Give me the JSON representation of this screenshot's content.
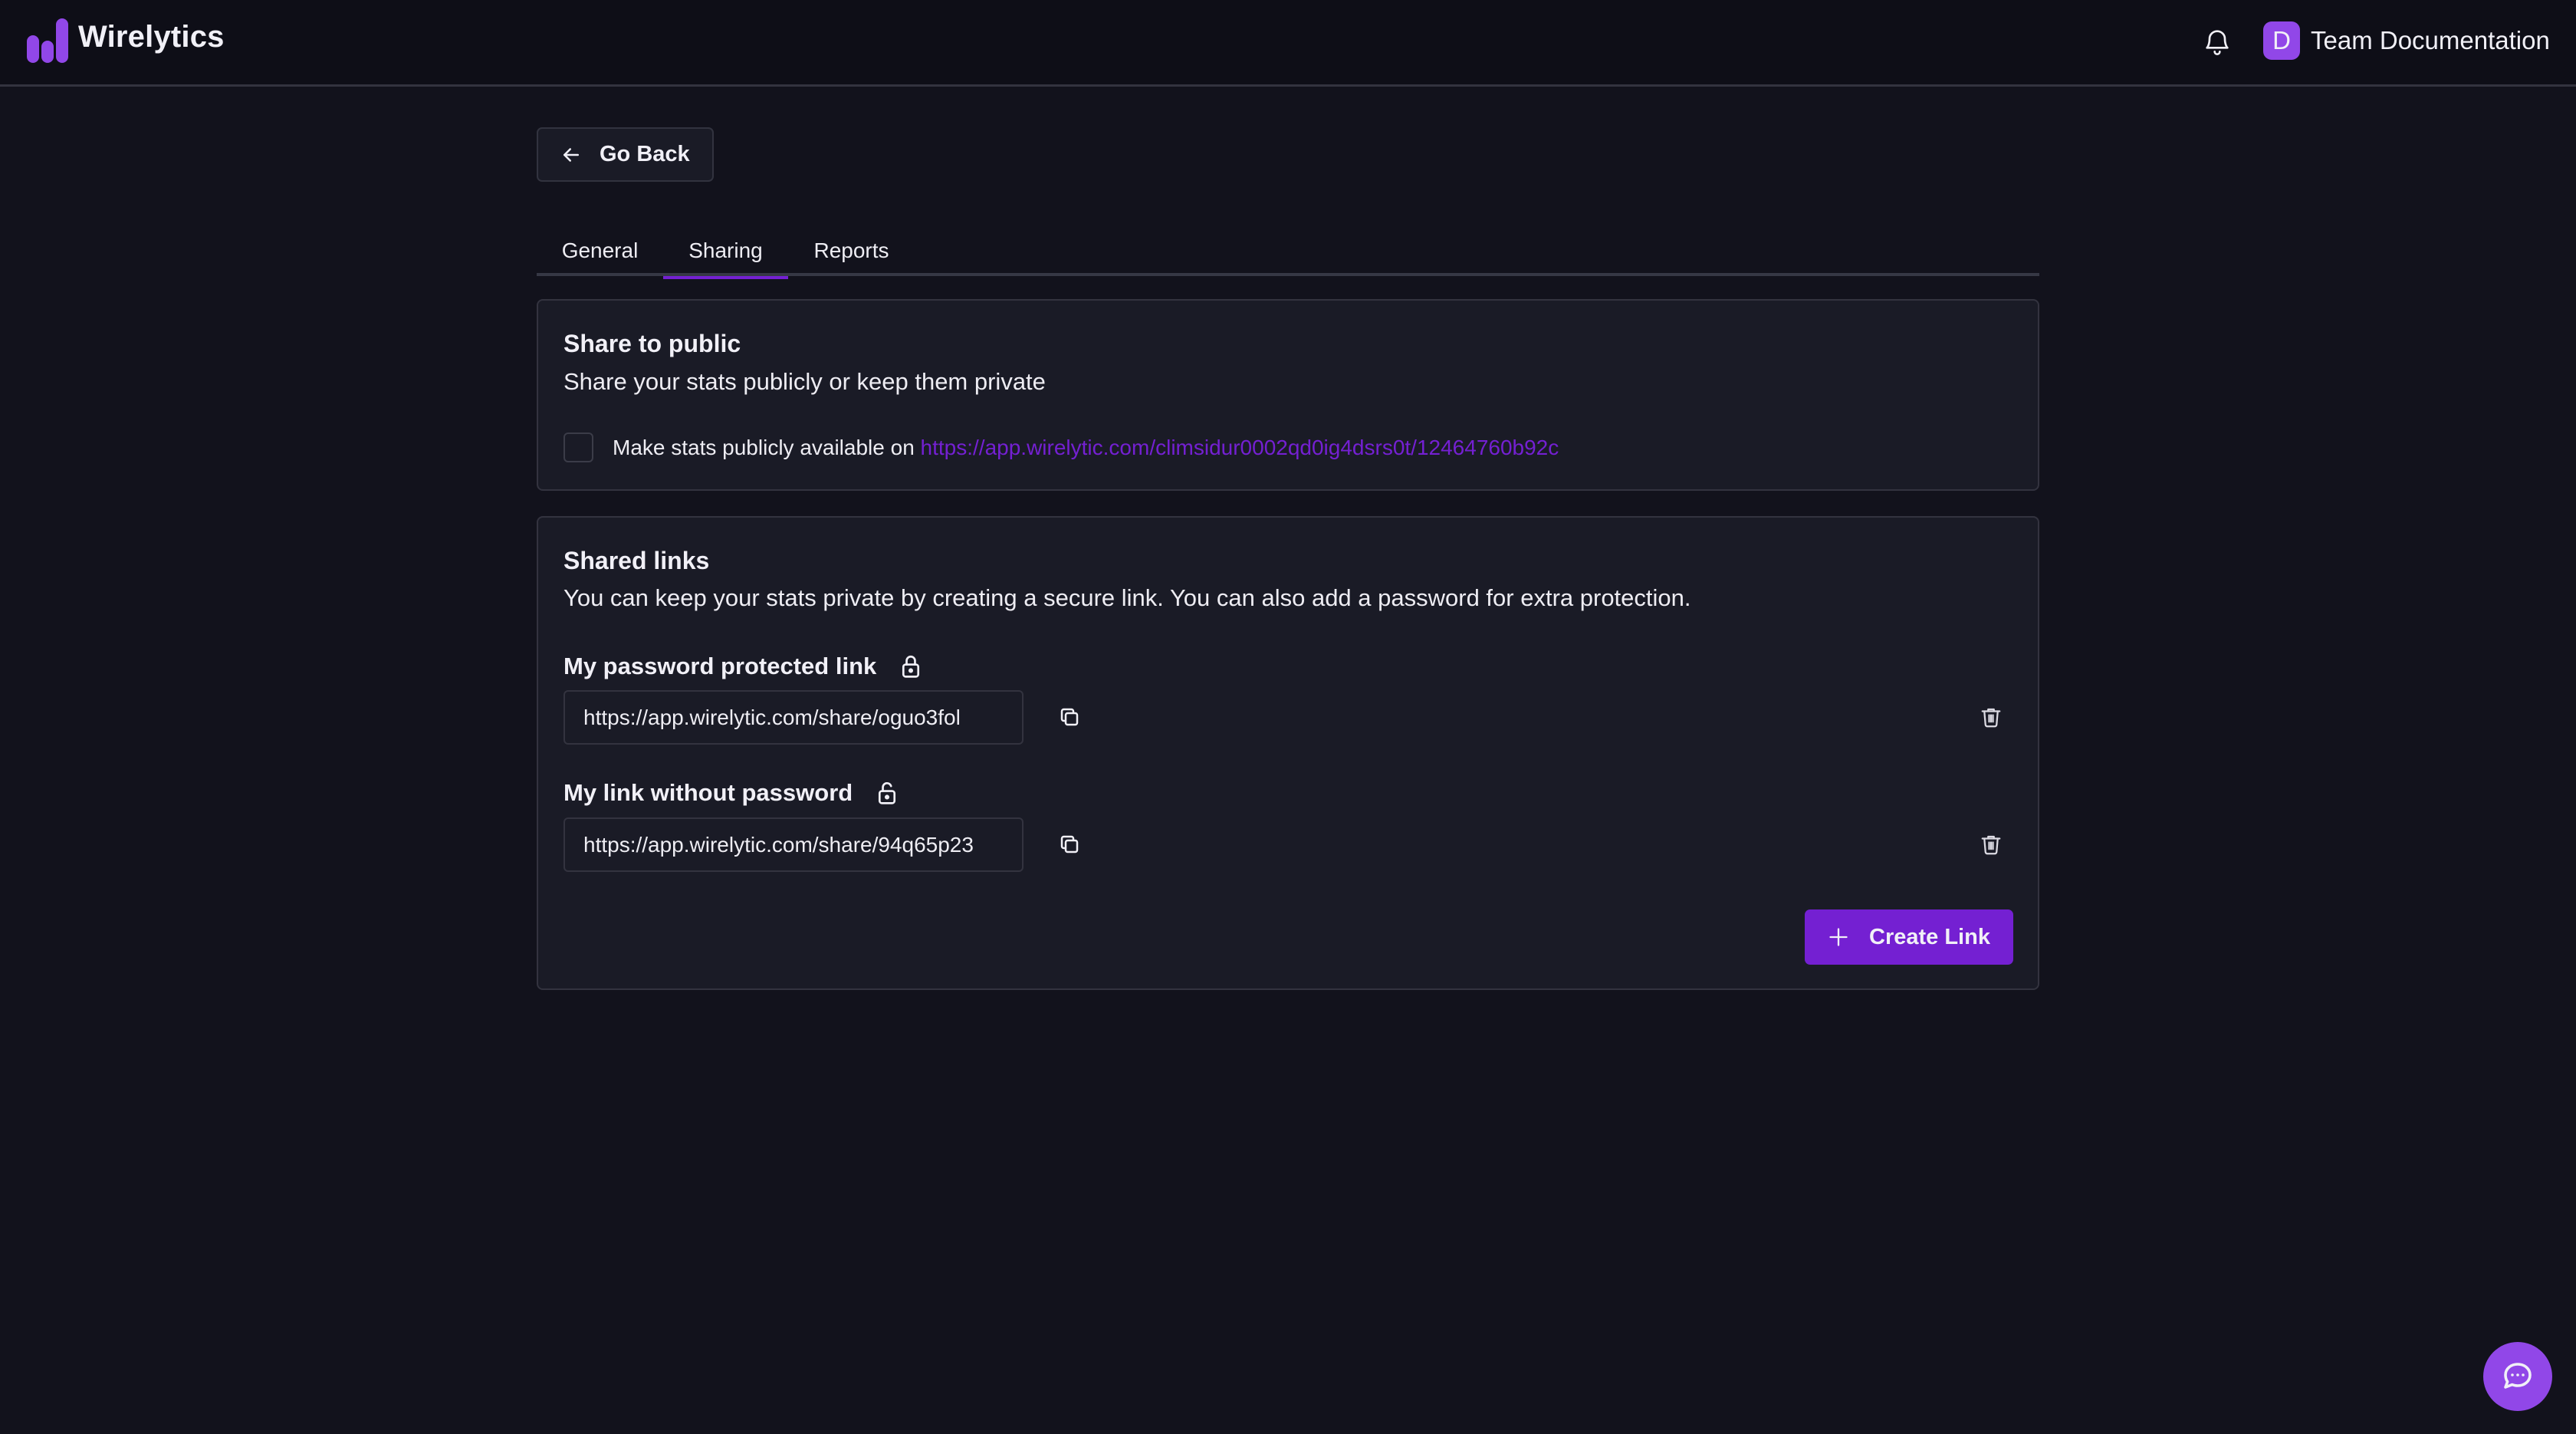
{
  "header": {
    "brand": "Wirelytics",
    "logo_icon": "bar-chart-logo-icon",
    "notification_icon": "bell-icon",
    "user": {
      "avatar_initial": "D",
      "name": "Team Documentation"
    }
  },
  "nav": {
    "go_back_label": "Go Back",
    "go_back_icon": "arrow-left-icon"
  },
  "tabs": [
    {
      "label": "General",
      "active": false
    },
    {
      "label": "Sharing",
      "active": true
    },
    {
      "label": "Reports",
      "active": false
    }
  ],
  "share_public": {
    "title": "Share to public",
    "description": "Share your stats publicly or keep them private",
    "checkbox_checked": false,
    "checkbox_label": "Make stats publicly available on ",
    "public_url": "https://app.wirelytic.com/climsidur0002qd0ig4dsrs0t/12464760b92c"
  },
  "shared_links": {
    "title": "Shared links",
    "description": "You can keep your stats private by creating a secure link. You can also add a password for extra protection.",
    "links": [
      {
        "name": "My password protected link",
        "lock_icon": "lock-closed-icon",
        "url": "https://app.wirelytic.com/share/oguo3fol"
      },
      {
        "name": "My link without password",
        "lock_icon": "lock-open-icon",
        "url": "https://app.wirelytic.com/share/94q65p23"
      }
    ],
    "copy_icon": "copy-icon",
    "delete_icon": "trash-icon",
    "create_label": "Create Link",
    "create_icon": "plus-icon"
  },
  "chat": {
    "icon": "chat-bubble-icon"
  },
  "colors": {
    "accent": "#7420d2",
    "brand_purple": "#9147e8",
    "background": "#12121c",
    "header_background": "#0e0e17",
    "card_background": "#1a1b26",
    "border": "#33333f",
    "text": "#f1f0f7"
  }
}
